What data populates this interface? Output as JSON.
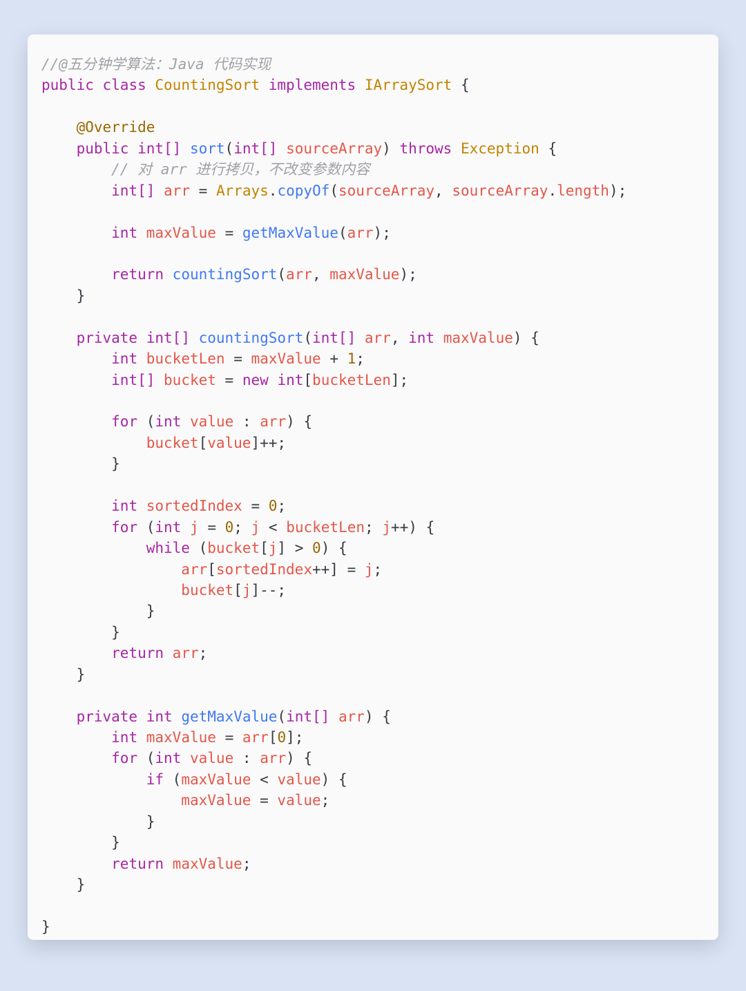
{
  "code": {
    "t": {
      "comment1": "//@五分钟学算法：Java 代码实现",
      "public": "public",
      "class": "class",
      "CountingSort": "CountingSort",
      "implements": "implements",
      "IArraySort": "IArraySort",
      "lbrace": "{",
      "rbrace": "}",
      "Override": "@Override",
      "int": "int",
      "intArr": "int[]",
      "sort": "sort",
      "lparen": "(",
      "rparen": ")",
      "sourceArray": "sourceArray",
      "throws": "throws",
      "Exception": "Exception",
      "comment2": "// 对 arr 进行拷贝，不改变参数内容",
      "arr": "arr",
      "eq": "=",
      "Arrays": "Arrays",
      "dot": ".",
      "copyOf": "copyOf",
      "comma": ",",
      "length": "length",
      "semi": ";",
      "maxValue": "maxValue",
      "getMaxValue": "getMaxValue",
      "return": "return",
      "countingSort": "countingSort",
      "private": "private",
      "bucketLen": "bucketLen",
      "plus": "+",
      "one": "1",
      "bucket": "bucket",
      "new": "new",
      "lbracket": "[",
      "rbracket": "]",
      "for": "for",
      "value": "value",
      "colon": ":",
      "plusplus": "++",
      "sortedIndex": "sortedIndex",
      "zero": "0",
      "j": "j",
      "lt": "<",
      "while": "while",
      "gt": ">",
      "minusminus": "--",
      "if": "if"
    }
  }
}
